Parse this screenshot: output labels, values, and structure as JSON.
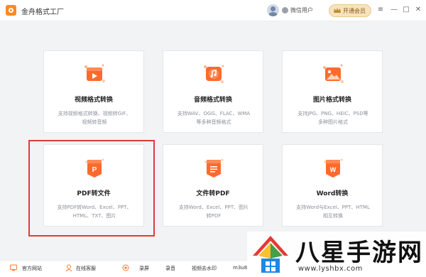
{
  "window": {
    "title": "金舟格式工厂",
    "user_name": "微信用户",
    "vip_label": "开通会员",
    "controls": {
      "menu": "≡",
      "minimize": "—",
      "maximize": "□",
      "close": "✕"
    }
  },
  "colors": {
    "accent": "#ff6a2b",
    "vip_bg": "#f7e3bd",
    "highlight_border": "#e03a3a"
  },
  "cards": [
    {
      "title": "视频格式转换",
      "desc1": "支持视频格式转换、视频转GIF、",
      "desc2": "视频转音频",
      "icon": "video-icon"
    },
    {
      "title": "音频格式转换",
      "desc1": "支持WAV、OGG、FLAC、WMA",
      "desc2": "等多种音频格式",
      "icon": "audio-icon"
    },
    {
      "title": "图片格式转换",
      "desc1": "支持JPG、PNG、HEIC、PSD等",
      "desc2": "多种图片格式",
      "icon": "image-icon"
    },
    {
      "title": "PDF转文件",
      "desc1": "支持PDF转Word、Excel、PPT、",
      "desc2": "HTML、TXT、图片",
      "icon": "pdf-icon",
      "icon_letter": "P"
    },
    {
      "title": "文件转PDF",
      "desc1": "支持Word、Excel、PPT、图片",
      "desc2": "转PDF",
      "icon": "file-to-pdf-icon"
    },
    {
      "title": "Word转换",
      "desc1": "支持Word与Excel、PPT、HTML",
      "desc2": "相互转换",
      "icon": "word-icon",
      "icon_letter": "W"
    }
  ],
  "bottom_bar": {
    "website": "官方网站",
    "support": "在线客服",
    "record_screen": "录屏",
    "record_audio": "录音",
    "remove_watermark": "视频去水印",
    "m3u8": "m3u8"
  },
  "watermark": {
    "title": "八星手游网",
    "url": "www.lyshbx.com"
  }
}
